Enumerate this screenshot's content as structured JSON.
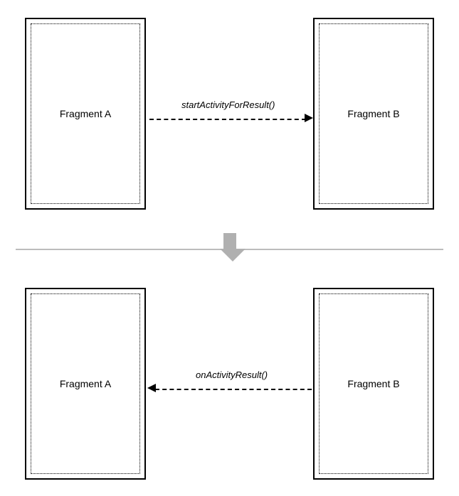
{
  "top": {
    "left_box": "Fragment A",
    "right_box": "Fragment B",
    "arrow_label": "startActivityForResult()",
    "arrow_dir": "right"
  },
  "bottom": {
    "left_box": "Fragment A",
    "right_box": "Fragment B",
    "arrow_label": "onActivityResult()",
    "arrow_dir": "left"
  }
}
